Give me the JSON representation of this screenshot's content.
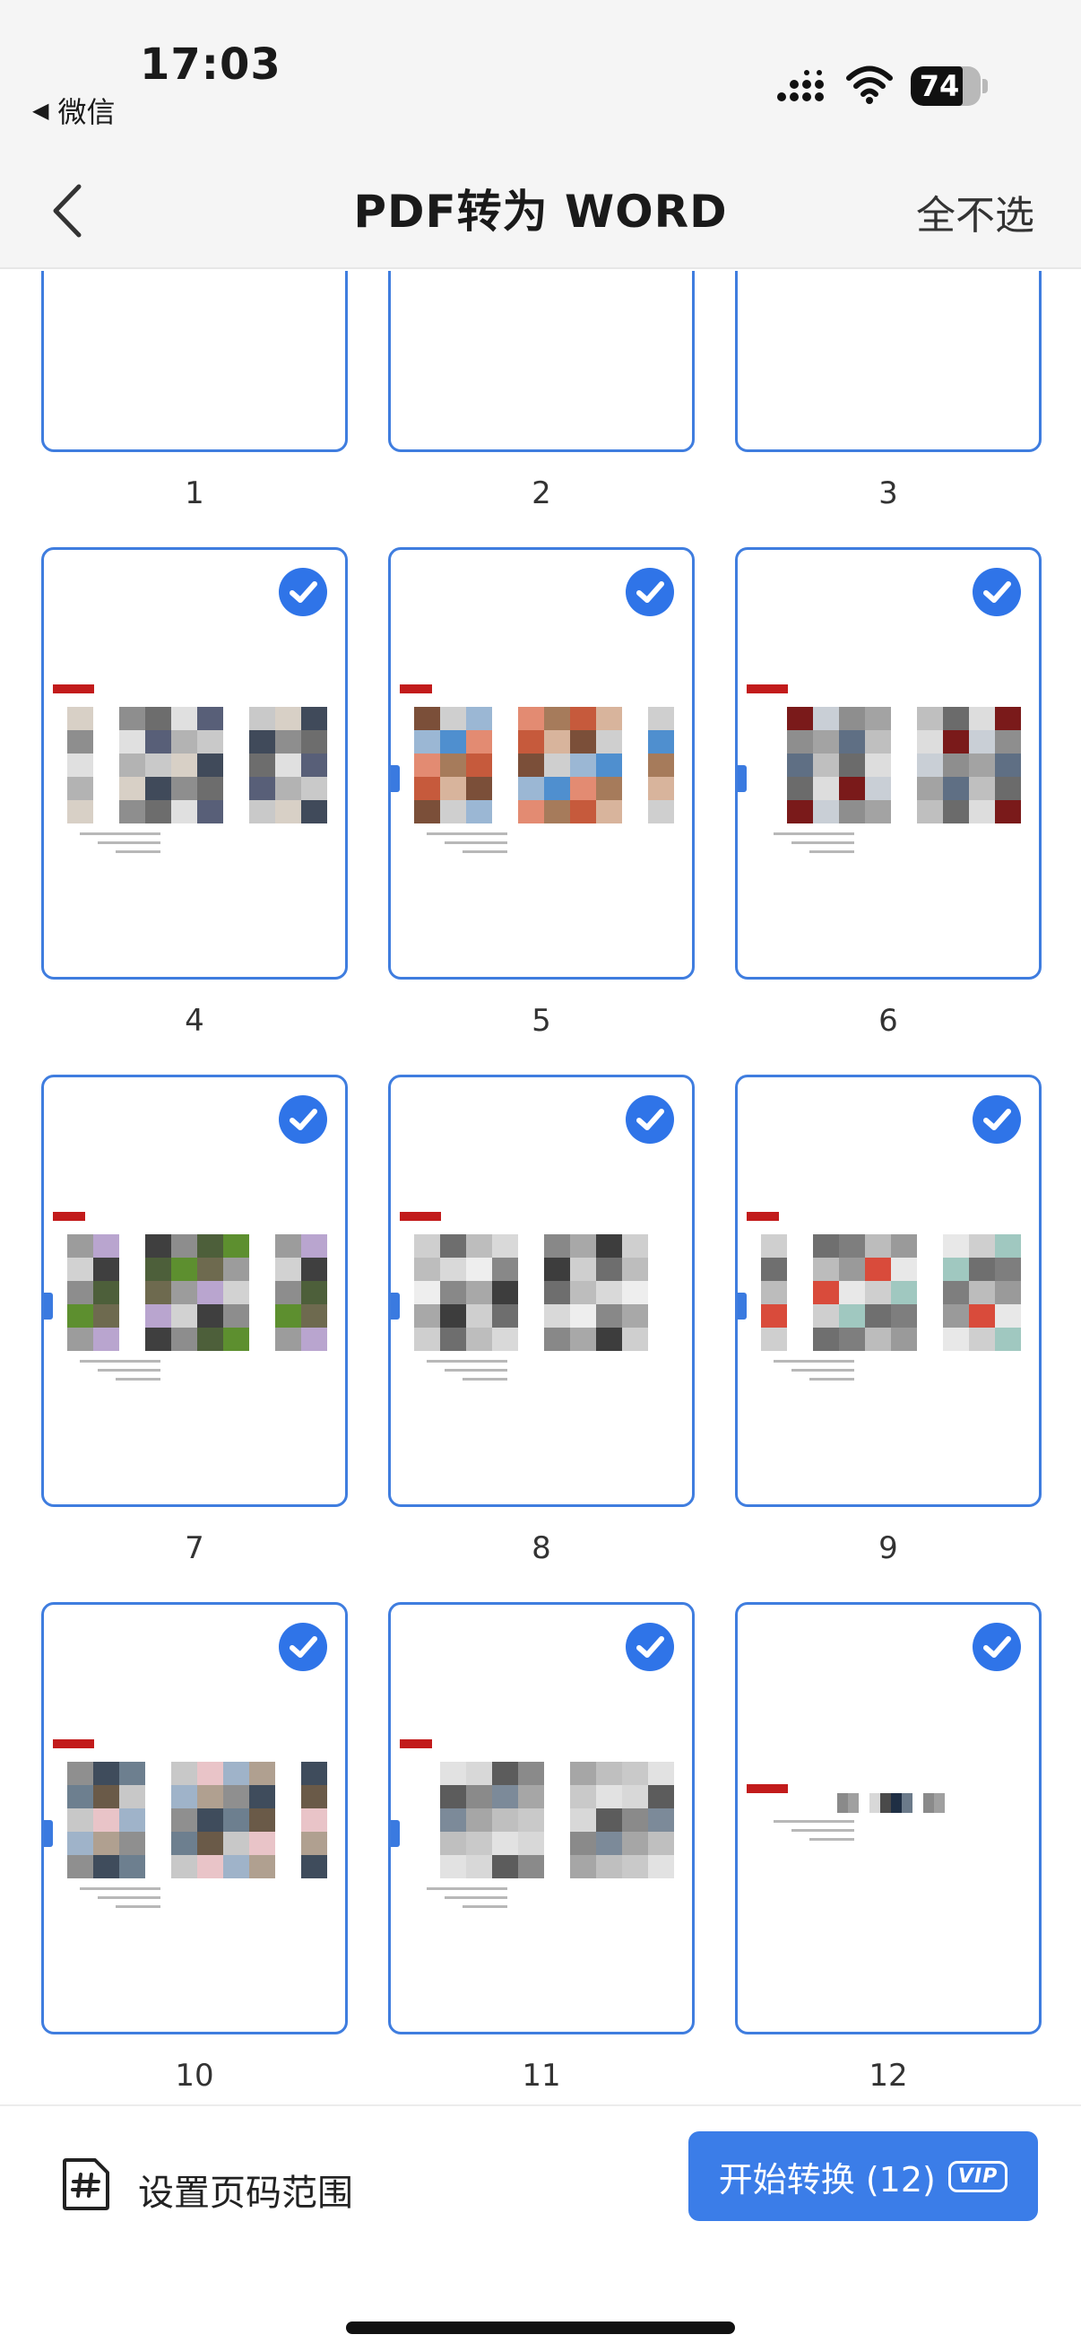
{
  "status_bar": {
    "time": "17:03",
    "back_app": "微信",
    "battery": "74",
    "battery_level": 0.74
  },
  "nav": {
    "title": "PDF转为 WORD",
    "action": "全不选"
  },
  "pages": [
    {
      "number": "1",
      "selected": false
    },
    {
      "number": "2",
      "selected": false
    },
    {
      "number": "3",
      "selected": false
    },
    {
      "number": "4",
      "selected": true
    },
    {
      "number": "5",
      "selected": true
    },
    {
      "number": "6",
      "selected": true
    },
    {
      "number": "7",
      "selected": true
    },
    {
      "number": "8",
      "selected": true
    },
    {
      "number": "9",
      "selected": true
    },
    {
      "number": "10",
      "selected": true
    },
    {
      "number": "11",
      "selected": true
    },
    {
      "number": "12",
      "selected": true
    }
  ],
  "bottom": {
    "range_label": "设置页码范围",
    "start_label": "开始转换 (12)",
    "vip_badge": "VIP"
  },
  "colors": {
    "accent": "#3b7de8",
    "thumb_border": "#3f7ddf",
    "check": "#2f74e8",
    "topbar_bg": "#f5f5f5"
  },
  "icons": {
    "back": "chevron-left-icon",
    "check": "checkmark-circle-icon",
    "range": "hash-document-icon"
  }
}
